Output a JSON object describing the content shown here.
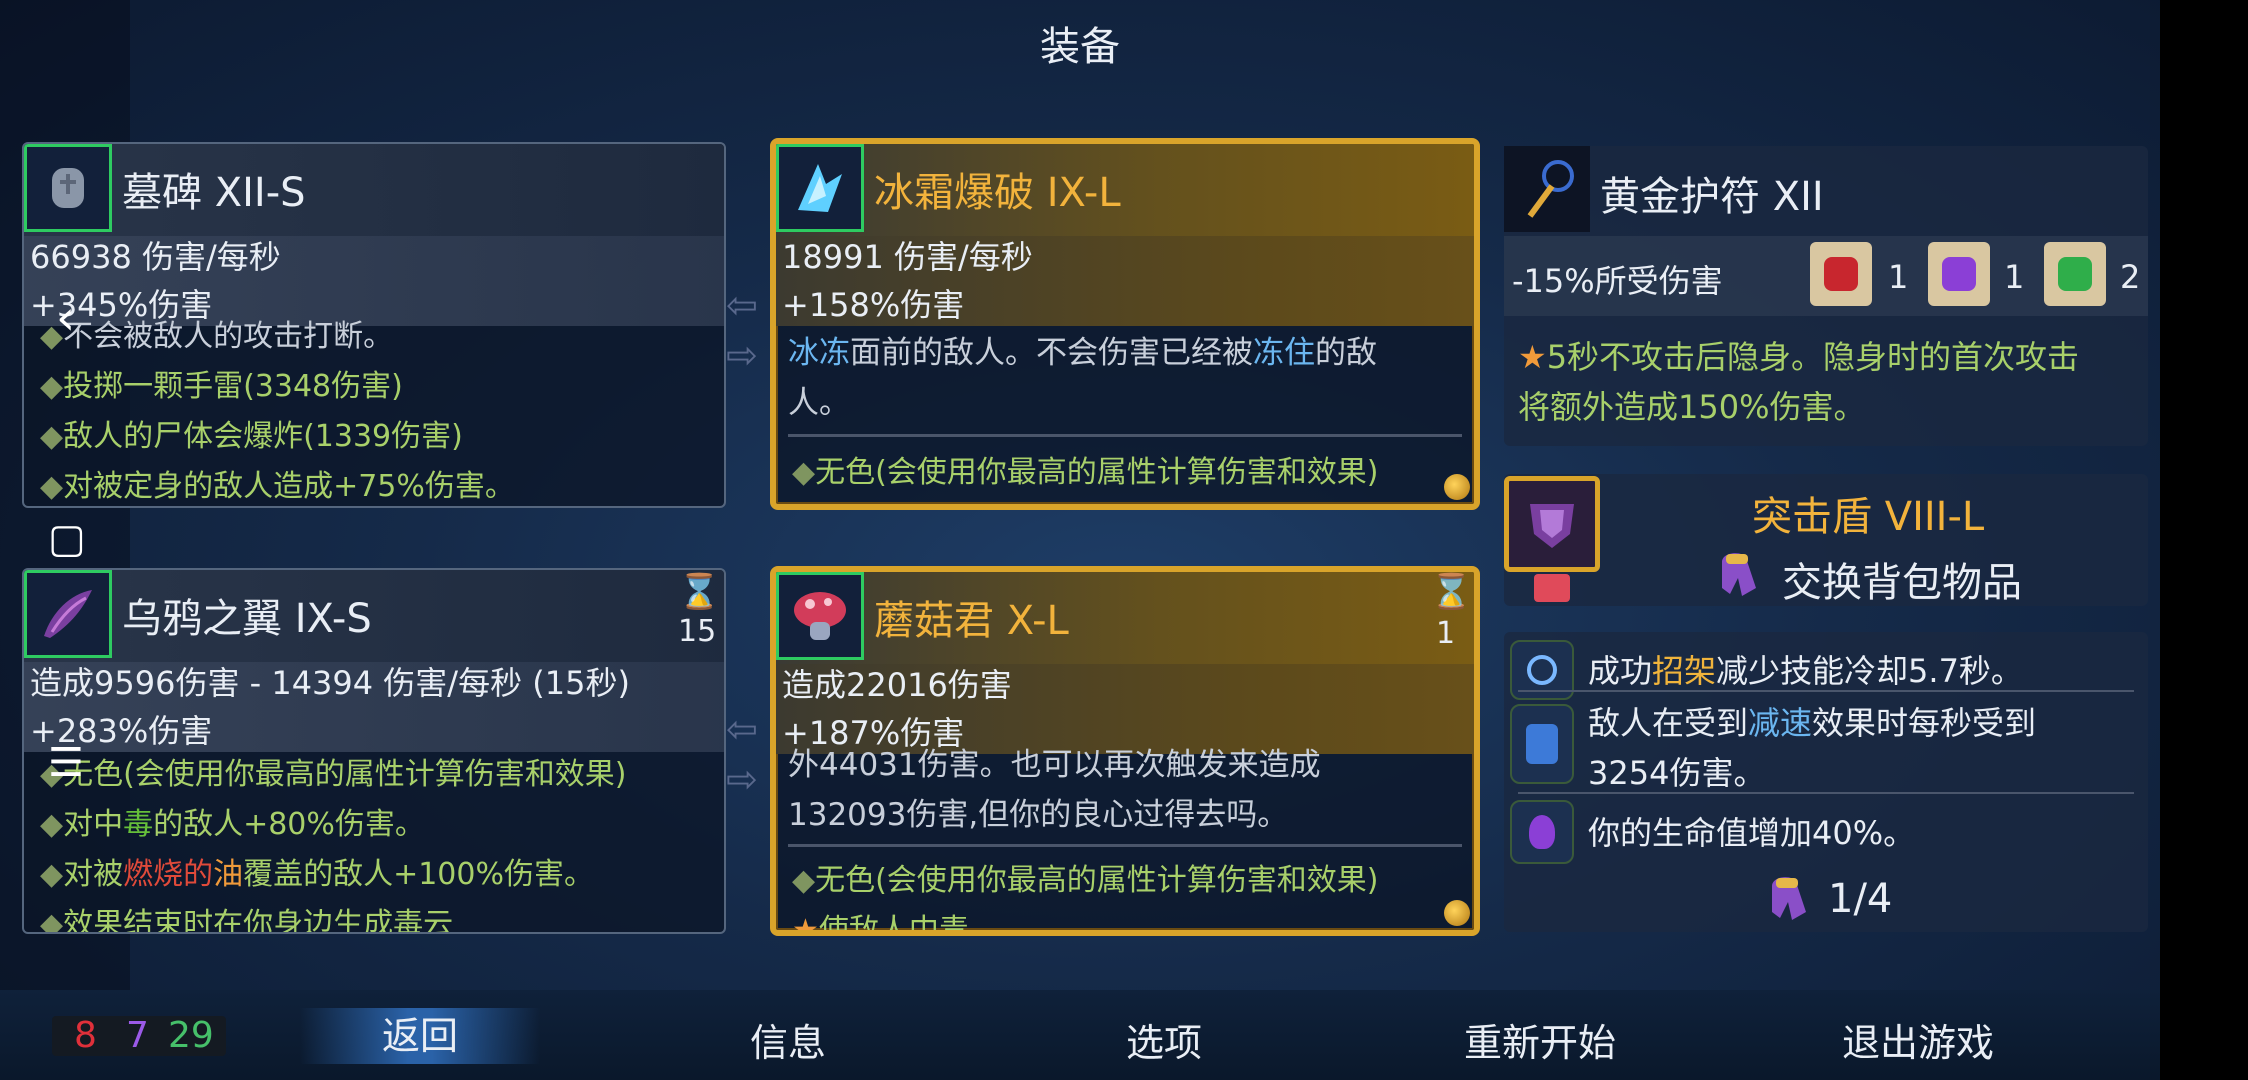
{
  "title": "装备",
  "weapons": {
    "tombstone": {
      "name": "墓碑 XII-S",
      "icon": "tombstone-icon",
      "dps": "66938 伤害/每秒",
      "damage": "+345%伤害",
      "lines": [
        "不会被敌人的攻击打断。",
        "投掷一颗手雷(3348伤害)",
        "敌人的尸体会爆炸(1339伤害)",
        "对被定身的敌人造成+75%伤害。"
      ]
    },
    "frost_blast": {
      "name": "冰霜爆破 IX-L",
      "icon": "ice-crystal-icon",
      "dps": "18991 伤害/每秒",
      "damage": "+158%伤害",
      "line1_a": "冰冻",
      "line1_b": "面前的敌人。不会伤害已经被",
      "line1_c": "冻住",
      "line1_d": "的敌",
      "line2": "人。",
      "affix": "无色(会使用你最高的属性计算伤害和效果)"
    },
    "crow_wings": {
      "name": "乌鸦之翼 IX-S",
      "icon": "crow-wings-icon",
      "cooldown": "15",
      "dps": "造成9596伤害 - 14394 伤害/每秒 (15秒)",
      "damage": "+283%伤害",
      "affix": "无色(会使用你最高的属性计算伤害和效果)",
      "line2_a": "对中",
      "line2_b": "毒",
      "line2_c": "的敌人+80%伤害。",
      "line3_a": "对被",
      "line3_b": "燃烧的",
      "line3_c": "油",
      "line3_d": "覆盖的敌人+100%伤害。",
      "line4": "效果结束时在你身边生成毒云"
    },
    "mushroom": {
      "name": "蘑菇君 X-L",
      "icon": "mushroom-icon",
      "cooldown": "1",
      "dps": "造成22016伤害",
      "damage": "+187%伤害",
      "line1": "外44031伤害。也可以再次触发来造成",
      "line2": "132093伤害,但你的良心过得去吗。",
      "affix": "无色(会使用你最高的属性计算伤害和效果)",
      "line4": "使敌人中毒"
    }
  },
  "amulet": {
    "name": "黄金护符 XII",
    "icon": "golden-amulet-icon",
    "stat": "-15%所受伤害",
    "scrolls": [
      {
        "icon": "brutality-scroll-icon",
        "count": "1"
      },
      {
        "icon": "tactics-scroll-icon",
        "count": "1"
      },
      {
        "icon": "survival-scroll-icon",
        "count": "2"
      }
    ],
    "perk_line1": "5秒不攻击后隐身。隐身时的首次攻击",
    "perk_line2": "将额外造成150%伤害。"
  },
  "shield": {
    "name": "突击盾 VIII-L",
    "icon": "assault-shield-icon",
    "action": "交换背包物品",
    "action_icon": "backpack-icon"
  },
  "mutations": [
    {
      "icon": "parry-mutation-icon",
      "a": "成功",
      "b": "招架",
      "c": "减少技能冷却5.7秒。"
    },
    {
      "icon": "slow-mutation-icon",
      "a": "敌人在受到",
      "b": "减速",
      "c": "效果时每秒受到",
      "d": "3254伤害。"
    },
    {
      "icon": "vitality-mutation-icon",
      "a": "你的生命值增加40%。"
    }
  ],
  "backpack_count": "1/4",
  "resources": {
    "red": "8",
    "purple": "7",
    "green": "29"
  },
  "nav": {
    "back": "返回",
    "info": "信息",
    "options": "选项",
    "restart": "重新开始",
    "quit": "退出游戏"
  },
  "system_nav": {
    "back_glyph": "‹",
    "home_glyph": "▢",
    "menu_glyph": "☰"
  },
  "colors": {
    "gold_border": "#d9a42a",
    "legend_name": "#f2b33c",
    "affix_green": "#a8d06a",
    "freeze_blue": "#6bb6f0"
  }
}
